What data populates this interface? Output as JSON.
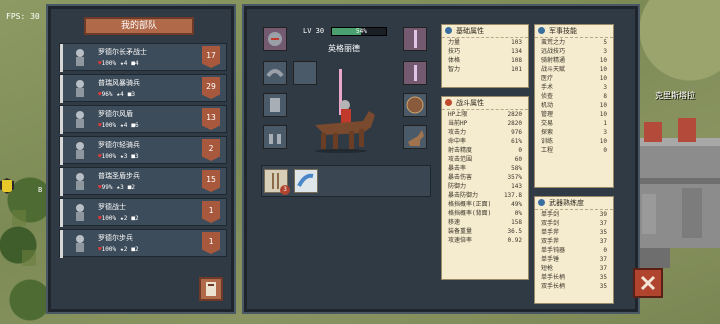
{
  "hud": {
    "fps": "FPS: 30"
  },
  "map": {
    "castle_label": "克里斯塔拉",
    "side_label": "B"
  },
  "army": {
    "title": "我的部队",
    "units": [
      {
        "name": "罗德尔长矛战士",
        "hp": "100%",
        "stars": "4",
        "level": "4",
        "count": "17"
      },
      {
        "name": "普瑞风暴骑兵",
        "hp": "96%",
        "stars": "4",
        "level": "3",
        "count": "29"
      },
      {
        "name": "罗德尔风盾",
        "hp": "100%",
        "stars": "4",
        "level": "6",
        "count": "13"
      },
      {
        "name": "罗德尔轻骑兵",
        "hp": "100%",
        "stars": "3",
        "level": "3",
        "count": "2"
      },
      {
        "name": "普瑞圣盾步兵",
        "hp": "99%",
        "stars": "3",
        "level": "2",
        "count": "15"
      },
      {
        "name": "罗德战士",
        "hp": "100%",
        "stars": "2",
        "level": "2",
        "count": "1"
      },
      {
        "name": "罗德尔步兵",
        "hp": "100%",
        "stars": "2",
        "level": "2",
        "count": "1"
      }
    ]
  },
  "hero": {
    "level": "LV 30",
    "xp": "54%",
    "xp_fraction": 0.54,
    "name": "英格丽德",
    "inventory": [
      {
        "count": "3"
      }
    ]
  },
  "base_attrs": {
    "title": "基础属性",
    "rows": [
      [
        "力量",
        "103"
      ],
      [
        "技巧",
        "134"
      ],
      [
        "体格",
        "108"
      ],
      [
        "智力",
        "101"
      ]
    ]
  },
  "combat_attrs": {
    "title": "战斗属性",
    "rows": [
      [
        "HP上限",
        "2820"
      ],
      [
        "当前HP",
        "2820"
      ],
      [
        "攻击力",
        "976"
      ],
      [
        "命中率",
        "61%"
      ],
      [
        "射击精度",
        "0"
      ],
      [
        "攻击范围",
        "60"
      ],
      [
        "暴击率",
        "58%"
      ],
      [
        "暴击伤害",
        "357%"
      ],
      [
        "防御力",
        "143"
      ],
      [
        "暴击防御力",
        "137.8"
      ],
      [
        "格挡概率(正面)",
        "49%"
      ],
      [
        "格挡概率(背面)",
        "0%"
      ],
      [
        "移速",
        "158"
      ],
      [
        "装备重量",
        "36.5"
      ],
      [
        "攻速倍率",
        "0.92"
      ]
    ]
  },
  "military_skills": {
    "title": "军事技能",
    "rows": [
      [
        "蛮荒之力",
        "5"
      ],
      [
        "远战技巧",
        "3"
      ],
      [
        "骑射精通",
        "10"
      ],
      [
        "战斗天赋",
        "10"
      ],
      [
        "医疗",
        "10"
      ],
      [
        "手术",
        "3"
      ],
      [
        "侦查",
        "8"
      ],
      [
        "机动",
        "10"
      ],
      [
        "管理",
        "10"
      ],
      [
        "交易",
        "1"
      ],
      [
        "探索",
        "3"
      ],
      [
        "训练",
        "10"
      ],
      [
        "工程",
        "0"
      ]
    ]
  },
  "weapon_mastery": {
    "title": "武器熟练度",
    "rows": [
      [
        "单手剑",
        "39"
      ],
      [
        "双手剑",
        "37"
      ],
      [
        "单手斧",
        "35"
      ],
      [
        "双手斧",
        "37"
      ],
      [
        "单手钝器",
        "0"
      ],
      [
        "单手锤",
        "37"
      ],
      [
        "短枪",
        "37"
      ],
      [
        "单手长柄",
        "35"
      ],
      [
        "双手长柄",
        "35"
      ]
    ]
  }
}
